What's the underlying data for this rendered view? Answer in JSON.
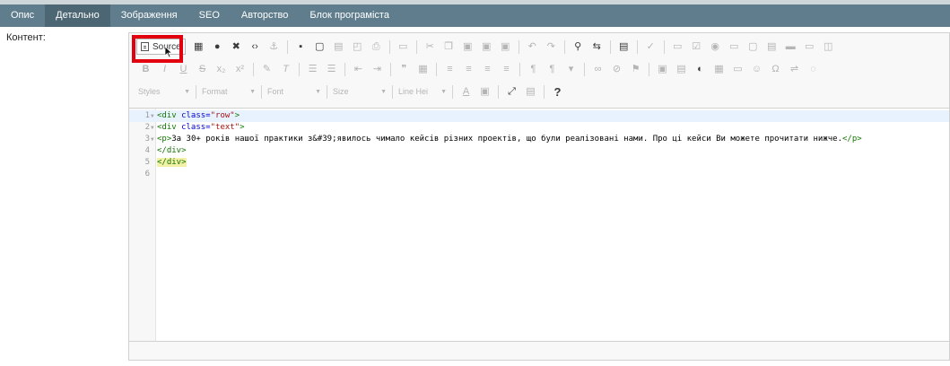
{
  "tabs": [
    {
      "label": "Опис",
      "active": false
    },
    {
      "label": "Детально",
      "active": true
    },
    {
      "label": "Зображення",
      "active": false
    },
    {
      "label": "SEO",
      "active": false
    },
    {
      "label": "Авторство",
      "active": false
    },
    {
      "label": "Блок програміста",
      "active": false
    }
  ],
  "field_label": "Контент:",
  "toolbar": {
    "source_label": "Source",
    "help_label": "?",
    "combos": {
      "styles": "Styles",
      "format": "Format",
      "font": "Font",
      "size": "Size",
      "lineheight": "Line Hei"
    }
  },
  "code": {
    "lines": [
      {
        "n": "1",
        "tag_open": "<div ",
        "attr": "class=",
        "value": "\"row\"",
        "tag_close": ">"
      },
      {
        "n": "2",
        "tag_open": "<div ",
        "attr": "class=",
        "value": "\"text\"",
        "tag_close": ">"
      },
      {
        "n": "3",
        "p_open": "<p>",
        "text": "За 30+ років нашої практики з&#39;явилось чимало кейсів різних проектів, що були реалізовані нами. Про ці кейси Ви можете прочитати нижче.",
        "p_close": "</p>"
      },
      {
        "n": "4",
        "tag": "</div>"
      },
      {
        "n": "5",
        "tag": "</div>"
      },
      {
        "n": "6"
      }
    ]
  },
  "colors": {
    "tab_bar": "#5f7d8c",
    "tab_active": "#4c6674",
    "highlight_box": "#e2000f"
  }
}
